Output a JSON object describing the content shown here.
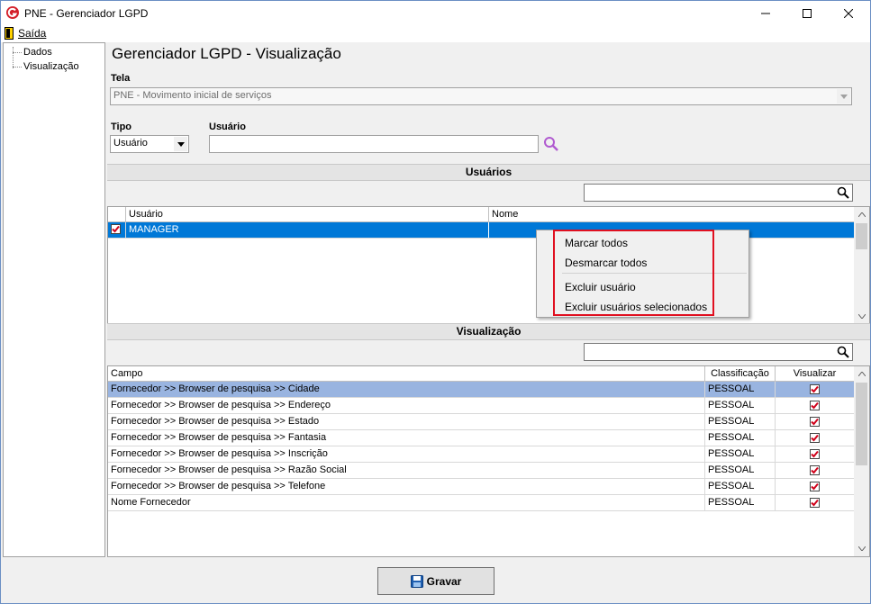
{
  "window": {
    "title": "PNE - Gerenciador LGPD"
  },
  "menu": {
    "exit_label": "Saída"
  },
  "tree": {
    "items": [
      "Dados",
      "Visualização"
    ]
  },
  "page": {
    "title": "Gerenciador LGPD - Visualização"
  },
  "tela": {
    "label": "Tela",
    "value": "PNE - Movimento inicial de serviços"
  },
  "tipo": {
    "label": "Tipo",
    "value": "Usuário"
  },
  "usuario": {
    "label": "Usuário",
    "value": ""
  },
  "users_section": {
    "title": "Usuários",
    "columns": [
      "Usuário",
      "Nome"
    ],
    "rows": [
      {
        "checked": true,
        "usuario": "MANAGER",
        "nome": ""
      }
    ]
  },
  "context_menu": {
    "items": [
      "Marcar todos",
      "Desmarcar todos",
      "Excluir usuário",
      "Excluir usuários selecionados"
    ]
  },
  "view_section": {
    "title": "Visualização",
    "columns": [
      "Campo",
      "Classificação",
      "Visualizar"
    ],
    "rows": [
      {
        "campo": "Fornecedor >> Browser de pesquisa >> Cidade",
        "classificacao": "PESSOAL",
        "visualizar": true
      },
      {
        "campo": "Fornecedor >> Browser de pesquisa >> Endereço",
        "classificacao": "PESSOAL",
        "visualizar": true
      },
      {
        "campo": "Fornecedor >> Browser de pesquisa >> Estado",
        "classificacao": "PESSOAL",
        "visualizar": true
      },
      {
        "campo": "Fornecedor >> Browser de pesquisa >> Fantasia",
        "classificacao": "PESSOAL",
        "visualizar": true
      },
      {
        "campo": "Fornecedor >> Browser de pesquisa >> Inscrição",
        "classificacao": "PESSOAL",
        "visualizar": true
      },
      {
        "campo": "Fornecedor >> Browser de pesquisa >> Razão Social",
        "classificacao": "PESSOAL",
        "visualizar": true
      },
      {
        "campo": "Fornecedor >> Browser de pesquisa >> Telefone",
        "classificacao": "PESSOAL",
        "visualizar": true
      },
      {
        "campo": "Nome Fornecedor",
        "classificacao": "PESSOAL",
        "visualizar": true
      }
    ]
  },
  "footer": {
    "save_label": "Gravar"
  },
  "colors": {
    "selected_row": "#0078d7",
    "selected_row_light": "#99b4e0",
    "highlight_box": "#e01020",
    "check": "#d0021b"
  },
  "icons": [
    "app-logo-icon",
    "exit-door-icon",
    "search-icon",
    "save-disk-icon"
  ]
}
